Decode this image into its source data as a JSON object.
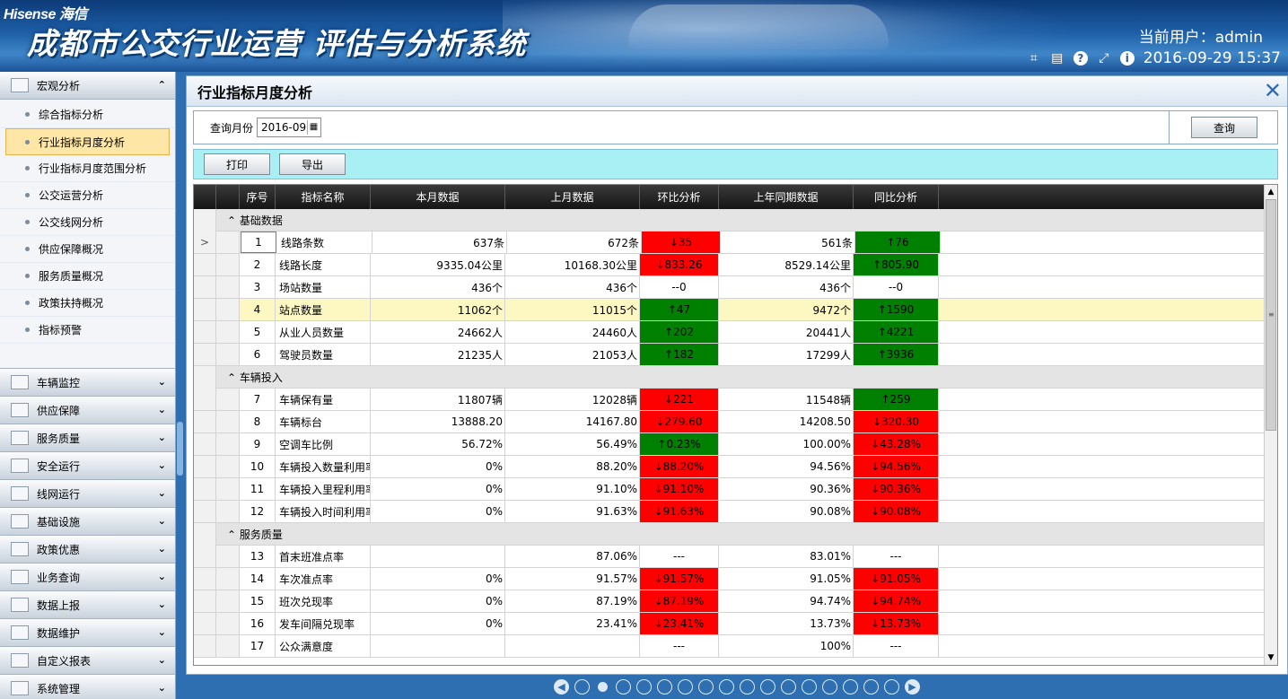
{
  "header": {
    "brand": "Hisense 海信",
    "system_title": "成都市公交行业运营 评估与分析系统",
    "user_label": "当前用户：",
    "user_name": "admin",
    "datetime": "2016-09-29 15:37",
    "tool_icons": [
      "crop-icon",
      "keyboard-icon",
      "help-icon",
      "expand-icon",
      "info-icon"
    ]
  },
  "sidebar": {
    "groups": [
      {
        "label": "宏观分析",
        "icon": "chart-icon",
        "expanded": true
      },
      {
        "label": "车辆监控",
        "icon": "camera-icon"
      },
      {
        "label": "供应保障",
        "icon": "supply-icon"
      },
      {
        "label": "服务质量",
        "icon": "service-icon"
      },
      {
        "label": "安全运行",
        "icon": "safety-icon"
      },
      {
        "label": "线网运行",
        "icon": "network-icon"
      },
      {
        "label": "基础设施",
        "icon": "infrastructure-icon"
      },
      {
        "label": "政策优惠",
        "icon": "policy-icon"
      },
      {
        "label": "业务查询",
        "icon": "query-icon"
      },
      {
        "label": "数据上报",
        "icon": "report-icon"
      },
      {
        "label": "数据维护",
        "icon": "maintenance-icon"
      },
      {
        "label": "自定义报表",
        "icon": "custom-report-icon"
      },
      {
        "label": "系统管理",
        "icon": "system-icon"
      }
    ],
    "sub_items": [
      "综合指标分析",
      "行业指标月度分析",
      "行业指标月度范围分析",
      "公交运营分析",
      "公交线网分析",
      "供应保障概况",
      "服务质量概况",
      "政策扶持概况",
      "指标预警"
    ],
    "active_sub": "行业指标月度分析"
  },
  "page": {
    "title": "行业指标月度分析",
    "query_label": "查询月份",
    "query_month": "2016-09",
    "query_button": "查询",
    "print_button": "打印",
    "export_button": "导出"
  },
  "grid": {
    "columns": [
      "序号",
      "指标名称",
      "本月数据",
      "上月数据",
      "环比分析",
      "上年同期数据",
      "同比分析"
    ],
    "groups": [
      {
        "title": "基础数据",
        "rows": [
          {
            "no": "1",
            "name": "线路条数",
            "cur": "637条",
            "prev": "672条",
            "mom": "↓35",
            "mom_color": "red",
            "yoy_base": "561条",
            "yoy": "↑76",
            "yoy_color": "green",
            "selected": true
          },
          {
            "no": "2",
            "name": "线路长度",
            "cur": "9335.04公里",
            "prev": "10168.30公里",
            "mom": "↓833.26",
            "mom_color": "red",
            "yoy_base": "8529.14公里",
            "yoy": "↑805.90",
            "yoy_color": "green"
          },
          {
            "no": "3",
            "name": "场站数量",
            "cur": "436个",
            "prev": "436个",
            "mom": "--0",
            "mom_color": "none",
            "yoy_base": "436个",
            "yoy": "--0",
            "yoy_color": "none"
          },
          {
            "no": "4",
            "name": "站点数量",
            "cur": "11062个",
            "prev": "11015个",
            "mom": "↑47",
            "mom_color": "green",
            "yoy_base": "9472个",
            "yoy": "↑1590",
            "yoy_color": "green",
            "highlight": true
          },
          {
            "no": "5",
            "name": "从业人员数量",
            "cur": "24662人",
            "prev": "24460人",
            "mom": "↑202",
            "mom_color": "green",
            "yoy_base": "20441人",
            "yoy": "↑4221",
            "yoy_color": "green"
          },
          {
            "no": "6",
            "name": "驾驶员数量",
            "cur": "21235人",
            "prev": "21053人",
            "mom": "↑182",
            "mom_color": "green",
            "yoy_base": "17299人",
            "yoy": "↑3936",
            "yoy_color": "green"
          }
        ]
      },
      {
        "title": "车辆投入",
        "rows": [
          {
            "no": "7",
            "name": "车辆保有量",
            "cur": "11807辆",
            "prev": "12028辆",
            "mom": "↓221",
            "mom_color": "red",
            "yoy_base": "11548辆",
            "yoy": "↑259",
            "yoy_color": "green"
          },
          {
            "no": "8",
            "name": "车辆标台",
            "cur": "13888.20",
            "prev": "14167.80",
            "mom": "↓279.60",
            "mom_color": "red",
            "yoy_base": "14208.50",
            "yoy": "↓320.30",
            "yoy_color": "red"
          },
          {
            "no": "9",
            "name": "空调车比例",
            "cur": "56.72%",
            "prev": "56.49%",
            "mom": "↑0.23%",
            "mom_color": "green",
            "yoy_base": "100.00%",
            "yoy": "↓43.28%",
            "yoy_color": "red"
          },
          {
            "no": "10",
            "name": "车辆投入数量利用率",
            "cur": "0%",
            "prev": "88.20%",
            "mom": "↓88.20%",
            "mom_color": "red",
            "yoy_base": "94.56%",
            "yoy": "↓94.56%",
            "yoy_color": "red"
          },
          {
            "no": "11",
            "name": "车辆投入里程利用率",
            "cur": "0%",
            "prev": "91.10%",
            "mom": "↓91.10%",
            "mom_color": "red",
            "yoy_base": "90.36%",
            "yoy": "↓90.36%",
            "yoy_color": "red"
          },
          {
            "no": "12",
            "name": "车辆投入时间利用率",
            "cur": "0%",
            "prev": "91.63%",
            "mom": "↓91.63%",
            "mom_color": "red",
            "yoy_base": "90.08%",
            "yoy": "↓90.08%",
            "yoy_color": "red"
          }
        ]
      },
      {
        "title": "服务质量",
        "rows": [
          {
            "no": "13",
            "name": "首末班准点率",
            "cur": "",
            "prev": "87.06%",
            "mom": "---",
            "mom_color": "none",
            "yoy_base": "83.01%",
            "yoy": "---",
            "yoy_color": "none"
          },
          {
            "no": "14",
            "name": "车次准点率",
            "cur": "0%",
            "prev": "91.57%",
            "mom": "↓91.57%",
            "mom_color": "red",
            "yoy_base": "91.05%",
            "yoy": "↓91.05%",
            "yoy_color": "red"
          },
          {
            "no": "15",
            "name": "班次兑现率",
            "cur": "0%",
            "prev": "87.19%",
            "mom": "↓87.19%",
            "mom_color": "red",
            "yoy_base": "94.74%",
            "yoy": "↓94.74%",
            "yoy_color": "red"
          },
          {
            "no": "16",
            "name": "发车间隔兑现率",
            "cur": "0%",
            "prev": "23.41%",
            "mom": "↓23.41%",
            "mom_color": "red",
            "yoy_base": "13.73%",
            "yoy": "↓13.73%",
            "yoy_color": "red"
          },
          {
            "no": "17",
            "name": "公众满意度",
            "cur": "",
            "prev": "",
            "mom": "---",
            "mom_color": "none",
            "yoy_base": "100%",
            "yoy": "---",
            "yoy_color": "none"
          }
        ]
      }
    ]
  },
  "pager": {
    "pages": 16,
    "current": 1
  }
}
